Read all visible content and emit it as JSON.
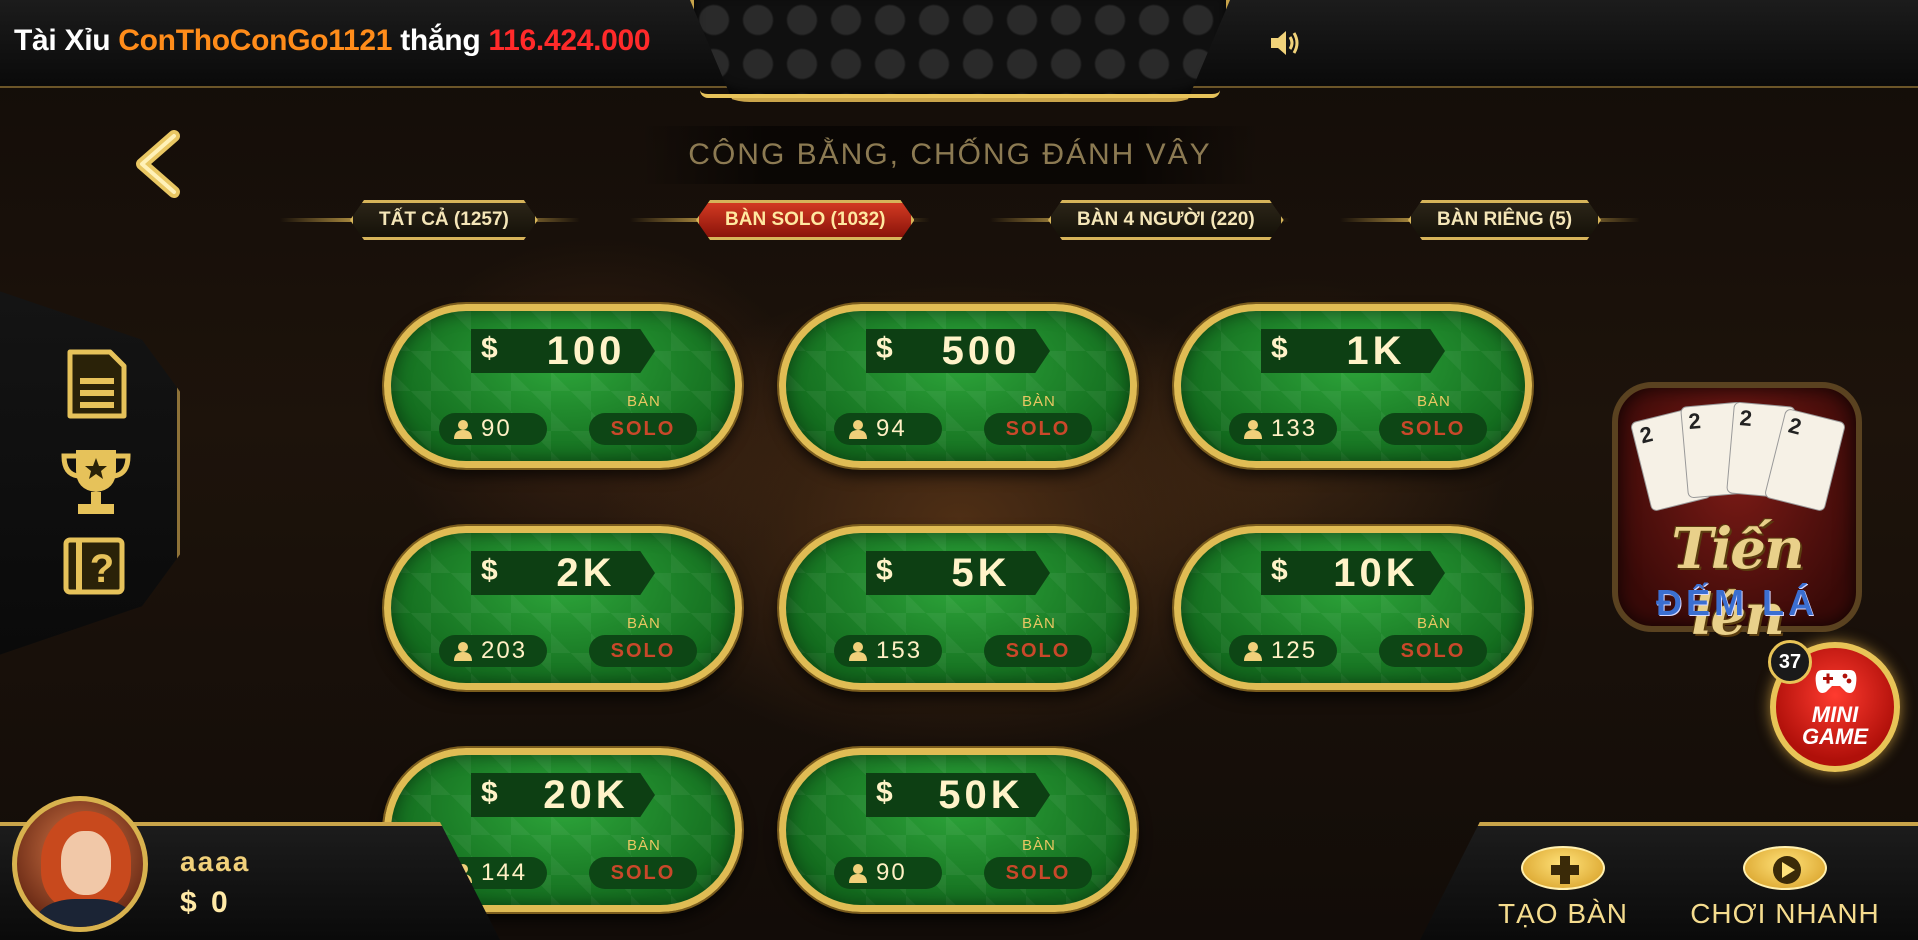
{
  "topbar": {
    "game": "Tài Xỉu",
    "winner": "ConThoConGo1121",
    "verb": "thắng",
    "amount": "116.424.000"
  },
  "slogan": "CÔNG BẰNG, CHỐNG ĐÁNH VÂY",
  "tabs": [
    {
      "label": "TẤT CẢ (1257)",
      "active": false
    },
    {
      "label": "BÀN SOLO (1032)",
      "active": true
    },
    {
      "label": "BÀN 4 NGƯỜI (220)",
      "active": false
    },
    {
      "label": "BÀN RIÊNG (5)",
      "active": false
    }
  ],
  "side_menu": [
    "document-icon",
    "trophy-icon",
    "help-icon"
  ],
  "table_labels": {
    "currency": "$",
    "ban": "BÀN",
    "mode": "SOLO"
  },
  "tables": [
    {
      "bet": "100",
      "players": "90"
    },
    {
      "bet": "500",
      "players": "94"
    },
    {
      "bet": "1K",
      "players": "133"
    },
    {
      "bet": "2K",
      "players": "203"
    },
    {
      "bet": "5K",
      "players": "153"
    },
    {
      "bet": "10K",
      "players": "125"
    },
    {
      "bet": "20K",
      "players": "144"
    },
    {
      "bet": "50K",
      "players": "90"
    }
  ],
  "game_logo": {
    "title": "Tiến lên",
    "subtitle": "ĐẾM LÁ",
    "cards": [
      "2",
      "2",
      "2",
      "2"
    ]
  },
  "mini_game": {
    "badge": "37",
    "line1": "MINI",
    "line2": "GAME"
  },
  "user": {
    "name": "aaaa",
    "currency": "$",
    "balance": "0"
  },
  "actions": {
    "create": "TẠO BÀN",
    "quick": "CHƠI NHANH"
  },
  "colors": {
    "gold": "#d6b45a",
    "felt": "#1e8a2b",
    "winner": "#ff8c1a",
    "amount": "#ff2a2a"
  }
}
